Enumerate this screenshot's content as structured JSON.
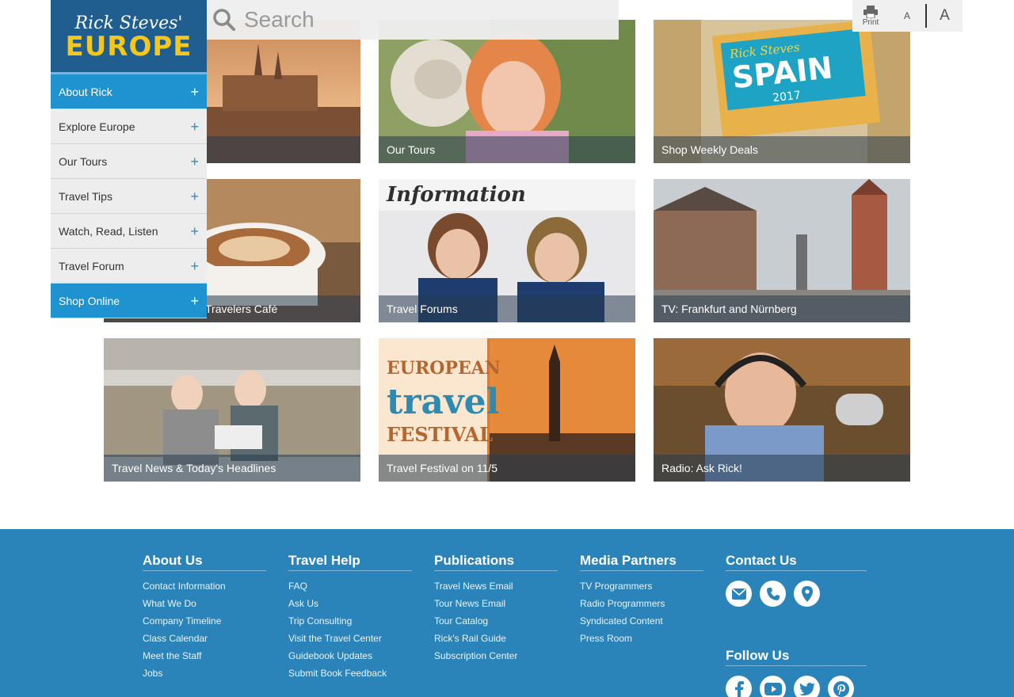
{
  "logo": {
    "script": "Rick Steves'",
    "big": "EUROPE"
  },
  "search": {
    "placeholder": "Search"
  },
  "tools": {
    "print": "Print",
    "small": "A",
    "large": "A"
  },
  "sidenav": [
    {
      "label": "About Rick",
      "style": "blue"
    },
    {
      "label": "Explore Europe",
      "style": "grey"
    },
    {
      "label": "Our Tours",
      "style": "grey"
    },
    {
      "label": "Travel Tips",
      "style": "grey"
    },
    {
      "label": "Watch, Read, Listen",
      "style": "grey"
    },
    {
      "label": "Travel Forum",
      "style": "grey"
    },
    {
      "label": "Shop Online",
      "style": "blue"
    }
  ],
  "tiles": [
    {
      "caption": ""
    },
    {
      "caption": "Our Tours"
    },
    {
      "caption": "Shop Weekly Deals"
    },
    {
      "caption": "Travelers Café"
    },
    {
      "caption": "Travel Forums"
    },
    {
      "caption": "TV: Frankfurt and Nürnberg"
    },
    {
      "caption": "Travel News & Today's Headlines"
    },
    {
      "caption": "Travel Festival on 11/5"
    },
    {
      "caption": "Radio: Ask Rick!"
    }
  ],
  "tile_texts": {
    "spain_brand": "Rick Steves",
    "spain_title": "SPAIN",
    "spain_year": "2017",
    "info_sign": "Information",
    "festival_1": "EUROPEAN",
    "festival_2": "travel",
    "festival_3": "FESTIVAL"
  },
  "footer": {
    "about": {
      "title": "About Us",
      "links": [
        "Contact Information",
        "What We Do",
        "Company Timeline",
        "Class Calendar",
        "Meet the Staff",
        "Jobs"
      ]
    },
    "help": {
      "title": "Travel Help",
      "links": [
        "FAQ",
        "Ask Us",
        "Trip Consulting",
        "Visit the Travel Center",
        "Guidebook Updates",
        "Submit Book Feedback"
      ]
    },
    "pubs": {
      "title": "Publications",
      "links": [
        "Travel News Email",
        "Tour News Email",
        "Tour Catalog",
        "Rick's Rail Guide",
        "Subscription Center"
      ]
    },
    "media": {
      "title": "Media Partners",
      "links": [
        "TV Programmers",
        "Radio Programmers",
        "Syndicated Content",
        "Press Room"
      ]
    },
    "contact": {
      "title": "Contact Us"
    },
    "follow": {
      "title": "Follow Us"
    }
  },
  "colors": {
    "brand_blue": "#1f93cf",
    "logo_blue": "#1f5e8e",
    "footer_blue": "#2a84b9",
    "logo_yellow": "#f7c61b"
  }
}
